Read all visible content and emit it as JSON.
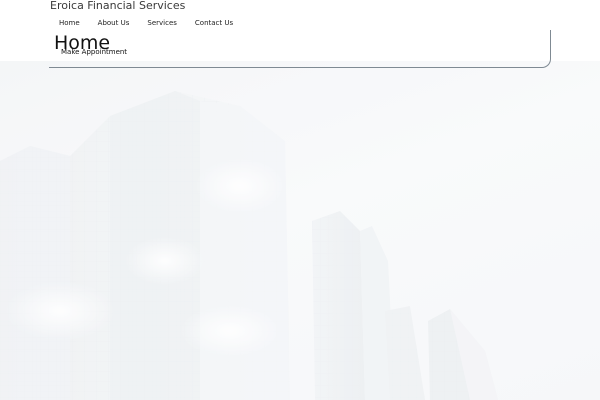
{
  "site": {
    "title": "Eroica Financial Services"
  },
  "nav": {
    "items": [
      {
        "label": "Home"
      },
      {
        "label": "About Us"
      },
      {
        "label": "Services"
      },
      {
        "label": "Contact Us"
      }
    ]
  },
  "page": {
    "heading": "Home",
    "appointment_link": "Make Appointment"
  },
  "colors": {
    "text": "#111111",
    "panel_border": "#7f8a93",
    "hero_tint": "#f3f5f7"
  }
}
